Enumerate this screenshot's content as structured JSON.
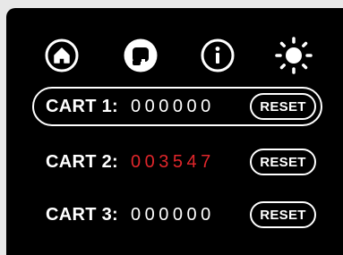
{
  "toolbar": {
    "icons": [
      "home-icon",
      "sign-icon",
      "info-icon",
      "brightness-icon"
    ]
  },
  "carts": [
    {
      "label": "CART 1:",
      "count": "000000",
      "reset_label": "RESET",
      "selected": true
    },
    {
      "label": "CART 2:",
      "count": "003547",
      "reset_label": "RESET",
      "selected": false,
      "count_color": "#e0262b"
    },
    {
      "label": "CART 3:",
      "count": "000000",
      "reset_label": "RESET",
      "selected": false
    }
  ],
  "colors": {
    "background": "#000000",
    "foreground": "#ffffff",
    "active_count": "#e0262b"
  }
}
